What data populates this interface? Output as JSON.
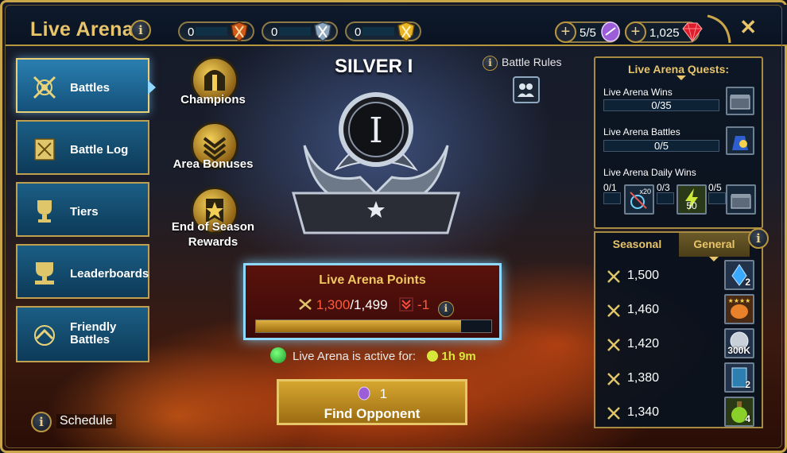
{
  "header": {
    "title": "Live Arena",
    "counters": [
      {
        "value": "0",
        "color": "#e05a1a"
      },
      {
        "value": "0",
        "color": "#7f9bb5"
      },
      {
        "value": "0",
        "color": "#e3b324"
      }
    ],
    "energy": "5/5",
    "gems": "1,025"
  },
  "nav": [
    {
      "label": "Battles",
      "icon": "crossed-axes-icon",
      "active": true
    },
    {
      "label": "Battle Log",
      "icon": "scroll-icon"
    },
    {
      "label": "Tiers",
      "icon": "trophy-icon"
    },
    {
      "label": "Leaderboards",
      "icon": "trophy-stack-icon"
    },
    {
      "label": "Friendly Battles",
      "icon": "handshake-icon"
    }
  ],
  "mid_actions": [
    "Champions",
    "Area Bonuses",
    "End of Season Rewards"
  ],
  "tier": {
    "name": "SILVER I",
    "numeral": "I"
  },
  "battle_rules": "Battle Rules",
  "points": {
    "title": "Live Arena Points",
    "current": "1,300",
    "separator": "/",
    "target": "1,499",
    "delta": "-1",
    "progress": 0.87
  },
  "active": {
    "label": "Live Arena is active for:",
    "time": "1h 9m"
  },
  "find": {
    "cost": "1",
    "label": "Find Opponent"
  },
  "schedule": "Schedule",
  "quests": {
    "title": "Live Arena Quests:",
    "items": [
      {
        "label": "Live Arena Wins",
        "progress": "0/35"
      },
      {
        "label": "Live Arena Battles",
        "progress": "0/5"
      }
    ],
    "daily": {
      "label": "Live Arena Daily Wins",
      "steps": [
        "0/1",
        "0/3",
        "0/5"
      ],
      "rewards": [
        "x20",
        "50"
      ]
    }
  },
  "rewards": {
    "tabs": [
      "Seasonal",
      "General"
    ],
    "selected_tab": "General",
    "rows": [
      {
        "points": "1,500",
        "count": "2"
      },
      {
        "points": "1,460",
        "count": ""
      },
      {
        "points": "1,420",
        "count": "300K"
      },
      {
        "points": "1,380",
        "count": "2"
      },
      {
        "points": "1,340",
        "count": "4"
      }
    ]
  },
  "colors": {
    "gold": "#e8c46a",
    "panel": "#0e1a2c",
    "active_green": "#2ac43a",
    "points_red": "#ff5a3a"
  }
}
